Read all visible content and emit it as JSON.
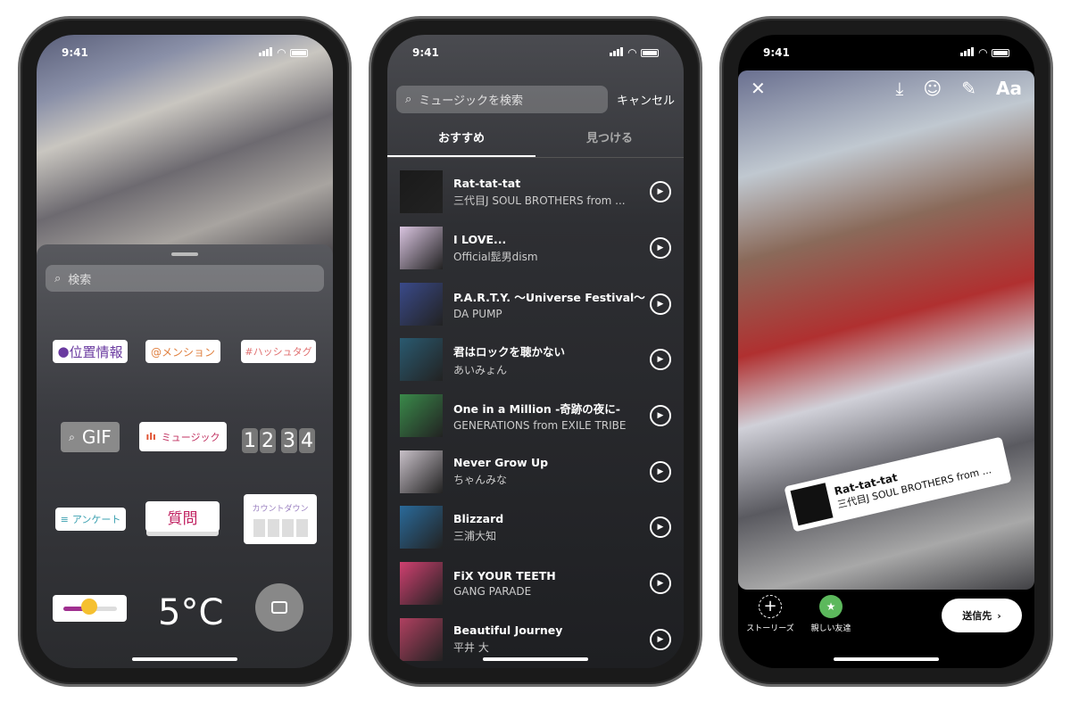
{
  "status_time": "9:41",
  "phone1": {
    "search_placeholder": "検索",
    "stickers": {
      "location": "位置情報",
      "mention": "@メンション",
      "hashtag": "#ハッシュタグ",
      "gif": "GIF",
      "music": "ミュージック",
      "time": [
        "1",
        "2",
        "3",
        "4"
      ],
      "poll": "アンケート",
      "question": "質問",
      "countdown": "カウントダウン",
      "temperature": "5°C"
    },
    "icons": [
      "search-icon",
      "location-pin-icon",
      "camera-icon",
      "heart-eyes-emoji-icon"
    ]
  },
  "phone2": {
    "search_placeholder": "ミュージックを検索",
    "cancel": "キャンセル",
    "tabs": [
      {
        "label": "おすすめ",
        "active": true
      },
      {
        "label": "見つける",
        "active": false
      }
    ],
    "songs": [
      {
        "title": "Rat-tat-tat",
        "artist": "三代目J SOUL BROTHERS from ...",
        "color": "#1a1a1a"
      },
      {
        "title": "I LOVE...",
        "artist": "Official髭男dism",
        "color": "#d9c4e0"
      },
      {
        "title": "P.A.R.T.Y. 〜Universe Festival〜",
        "artist": "DA PUMP",
        "color": "#3a4a8a"
      },
      {
        "title": "君はロックを聴かない",
        "artist": "あいみょん",
        "color": "#2a5a70"
      },
      {
        "title": "One in a Million -奇跡の夜に-",
        "artist": "GENERATIONS from EXILE TRIBE",
        "color": "#3a8a4a"
      },
      {
        "title": "Never Grow Up",
        "artist": "ちゃんみな",
        "color": "#c8c0c8"
      },
      {
        "title": "Blizzard",
        "artist": "三浦大知",
        "color": "#2a6a9a"
      },
      {
        "title": "FiX YOUR TEETH",
        "artist": "GANG PARADE",
        "color": "#d04070"
      },
      {
        "title": "Beautiful Journey",
        "artist": "平井 大",
        "color": "#b04060"
      }
    ]
  },
  "phone3": {
    "toolbar": {
      "text_tool": "Aa"
    },
    "music_sticker": {
      "title": "Rat-tat-tat",
      "artist": "三代目J SOUL BROTHERS from ..."
    },
    "bottom": {
      "stories": "ストーリーズ",
      "close_friends": "親しい友達",
      "send": "送信先"
    },
    "accent_green": "#5cb85c"
  }
}
